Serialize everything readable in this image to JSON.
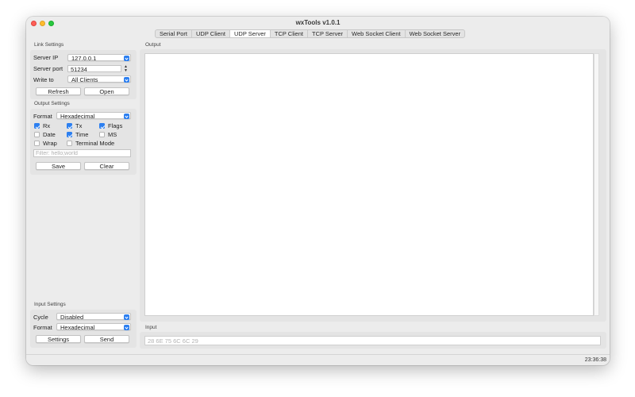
{
  "window": {
    "title": "wxTools v1.0.1"
  },
  "tabs": [
    "Serial Port",
    "UDP Client",
    "UDP Server",
    "TCP Client",
    "TCP Server",
    "Web Socket Client",
    "Web Socket Server"
  ],
  "active_tab": "UDP Server",
  "link_settings": {
    "group_label": "Link Settings",
    "server_ip_label": "Server IP",
    "server_ip_value": "127.0.0.1",
    "server_port_label": "Server port",
    "server_port_value": "51234",
    "write_to_label": "Write to",
    "write_to_value": "All Clients",
    "refresh_label": "Refresh",
    "open_label": "Open"
  },
  "output_settings": {
    "group_label": "Output Settings",
    "format_label": "Format",
    "format_value": "Hexadecimal",
    "checkboxes": [
      {
        "label": "Rx",
        "checked": true
      },
      {
        "label": "Tx",
        "checked": true
      },
      {
        "label": "Flags",
        "checked": true
      },
      {
        "label": "Date",
        "checked": false
      },
      {
        "label": "Time",
        "checked": true
      },
      {
        "label": "MS",
        "checked": false
      },
      {
        "label": "Wrap",
        "checked": false
      },
      {
        "label": "Terminal Mode",
        "checked": false
      }
    ],
    "filter_placeholder": "Filter: hello;world",
    "save_label": "Save",
    "clear_label": "Clear"
  },
  "output": {
    "label": "Output"
  },
  "input_settings": {
    "group_label": "Input Settings",
    "cycle_label": "Cycle",
    "cycle_value": "Disabled",
    "format_label": "Format",
    "format_value": "Hexadecimal",
    "settings_label": "Settings",
    "send_label": "Send"
  },
  "input": {
    "label": "Input",
    "placeholder": "28 6E 75 6C 6C 29"
  },
  "status": {
    "time": "23:36:38"
  },
  "colors": {
    "accent": "#2c7ff0",
    "close": "#fe5f57",
    "minimize": "#febc2e",
    "maximize": "#28c840"
  }
}
